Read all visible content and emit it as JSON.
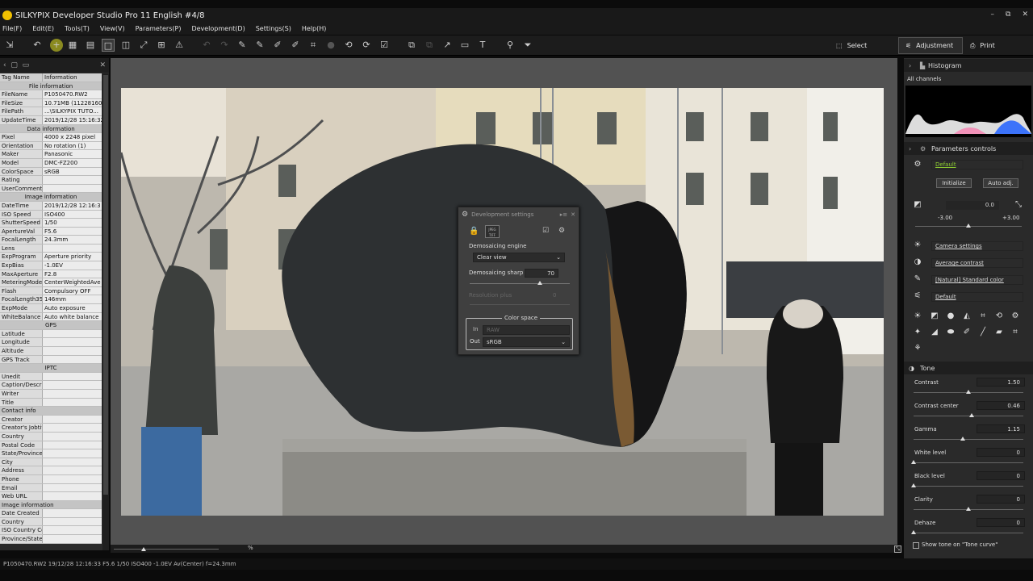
{
  "app": {
    "title": "SILKYPIX Developer Studio Pro 11 English   #4/8",
    "win_minimize": "–",
    "win_restore": "⧉",
    "win_close": "✕"
  },
  "menu": [
    "File(F)",
    "Edit(E)",
    "Tools(T)",
    "View(V)",
    "Parameters(P)",
    "Development(D)",
    "Settings(S)",
    "Help(H)"
  ],
  "modes": {
    "select": "Select",
    "adjustment": "Adjustment",
    "print": "Print"
  },
  "exif": {
    "col_tag": "Tag Name",
    "col_info": "Information",
    "rows": [
      {
        "type": "sec",
        "k": "File information"
      },
      {
        "k": "FileName",
        "v": "P1050470.RW2"
      },
      {
        "k": "FileSize",
        "v": "10.71MB (11228160B"
      },
      {
        "k": "FilePath",
        "v": "...\\SILKYPIX TUTO..."
      },
      {
        "k": "UpdateTime",
        "v": "2019/12/28 15:16:32"
      },
      {
        "type": "sec",
        "k": "Data information"
      },
      {
        "k": "Pixel",
        "v": "4000 x 2248 pixel"
      },
      {
        "k": "Orientation",
        "v": "No rotation (1)"
      },
      {
        "k": "Maker",
        "v": "Panasonic"
      },
      {
        "k": "Model",
        "v": "DMC-FZ200"
      },
      {
        "k": "ColorSpace",
        "v": "sRGB"
      },
      {
        "k": "Rating",
        "v": ""
      },
      {
        "k": "UserComment",
        "v": ""
      },
      {
        "type": "sec",
        "k": "Image information"
      },
      {
        "k": "DateTime",
        "v": "2019/12/28 12:16:3"
      },
      {
        "k": "ISO Speed",
        "v": "ISO400"
      },
      {
        "k": "ShutterSpeed",
        "v": "1/50"
      },
      {
        "k": "ApertureVal",
        "v": "F5.6"
      },
      {
        "k": "FocalLength",
        "v": "24.3mm"
      },
      {
        "k": "Lens",
        "v": ""
      },
      {
        "k": "ExpProgram",
        "v": "Aperture priority"
      },
      {
        "k": "ExpBias",
        "v": "-1.0EV"
      },
      {
        "k": "MaxAperture",
        "v": "F2.8"
      },
      {
        "k": "MeteringMode",
        "v": "CenterWeightedAve"
      },
      {
        "k": "Flash",
        "v": "Compulsory OFF"
      },
      {
        "k": "FocalLength35",
        "v": "146mm"
      },
      {
        "k": "ExpMode",
        "v": "Auto exposure"
      },
      {
        "k": "WhiteBalance",
        "v": "Auto white balance"
      },
      {
        "type": "sec",
        "k": "GPS"
      },
      {
        "k": "Latitude",
        "v": ""
      },
      {
        "k": "Longitude",
        "v": ""
      },
      {
        "k": "Altitude",
        "v": ""
      },
      {
        "k": "GPS Track",
        "v": ""
      },
      {
        "type": "sec",
        "k": "IPTC"
      },
      {
        "k": "Unedit",
        "v": ""
      },
      {
        "k": "Caption/Descri",
        "v": ""
      },
      {
        "k": "Writer",
        "v": ""
      },
      {
        "k": "Title",
        "v": ""
      },
      {
        "type": "secleft",
        "k": "Contact info"
      },
      {
        "k": "Creator",
        "v": ""
      },
      {
        "k": "Creator's Jobtit",
        "v": ""
      },
      {
        "k": "Country",
        "v": ""
      },
      {
        "k": "Postal Code",
        "v": ""
      },
      {
        "k": "State/Province",
        "v": ""
      },
      {
        "k": "City",
        "v": ""
      },
      {
        "k": "Address",
        "v": ""
      },
      {
        "k": "Phone",
        "v": ""
      },
      {
        "k": "Email",
        "v": ""
      },
      {
        "k": "Web URL",
        "v": ""
      },
      {
        "type": "secleft",
        "k": "Image information"
      },
      {
        "k": "Date Created",
        "v": ""
      },
      {
        "k": "Country",
        "v": ""
      },
      {
        "k": "ISO Country Cc",
        "v": ""
      },
      {
        "k": "Province/State",
        "v": ""
      }
    ]
  },
  "dev_dialog": {
    "title": "Development settings",
    "jpeg_badge": "JPEG TIFF",
    "demosaic_label": "Demosaicing engine",
    "demosaic_value": "Clear view",
    "sharp_label": "Demosaicing sharp",
    "sharp_value": "70",
    "sharp_level": 0.7,
    "resolution_label": "Resolution plus",
    "resolution_value": "0",
    "color_space_label": "Color space",
    "in_label": "In",
    "in_value": "RAW",
    "out_label": "Out",
    "out_value": "sRGB"
  },
  "footer": {
    "zoom_unit": "%"
  },
  "status": "P1050470.RW2 19/12/28 12:16:33 F5.6 1/50 ISO400 -1.0EV Av(Center) f=24.3mm",
  "right": {
    "histogram": "Histogram",
    "channels": "All channels",
    "params": "Parameters controls",
    "preset": "Default",
    "initialize": "Initialize",
    "auto_adj": "Auto adj.",
    "exposure_value": "0.0",
    "exposure_min": "-3.00",
    "exposure_max": "+3.00",
    "camera_settings": "Camera settings",
    "contrast_preset": "Average contrast",
    "color_preset": "[Natural] Standard color",
    "sharp_preset": "Default",
    "tone": "Tone",
    "show_tone_curve": "Show tone on \"Tone curve\"",
    "tone_rows": [
      {
        "label": "Contrast",
        "value": "1.50",
        "level": 0.5
      },
      {
        "label": "Contrast center",
        "value": "0.46",
        "level": 0.53
      },
      {
        "label": "Gamma",
        "value": "1.15",
        "level": 0.45
      },
      {
        "label": "White level",
        "value": "0",
        "level": 0.0
      },
      {
        "label": "Black level",
        "value": "0",
        "level": 0.0
      },
      {
        "label": "Clarity",
        "value": "0",
        "level": 0.5
      },
      {
        "label": "Dehaze",
        "value": "0",
        "level": 0.0
      }
    ]
  }
}
